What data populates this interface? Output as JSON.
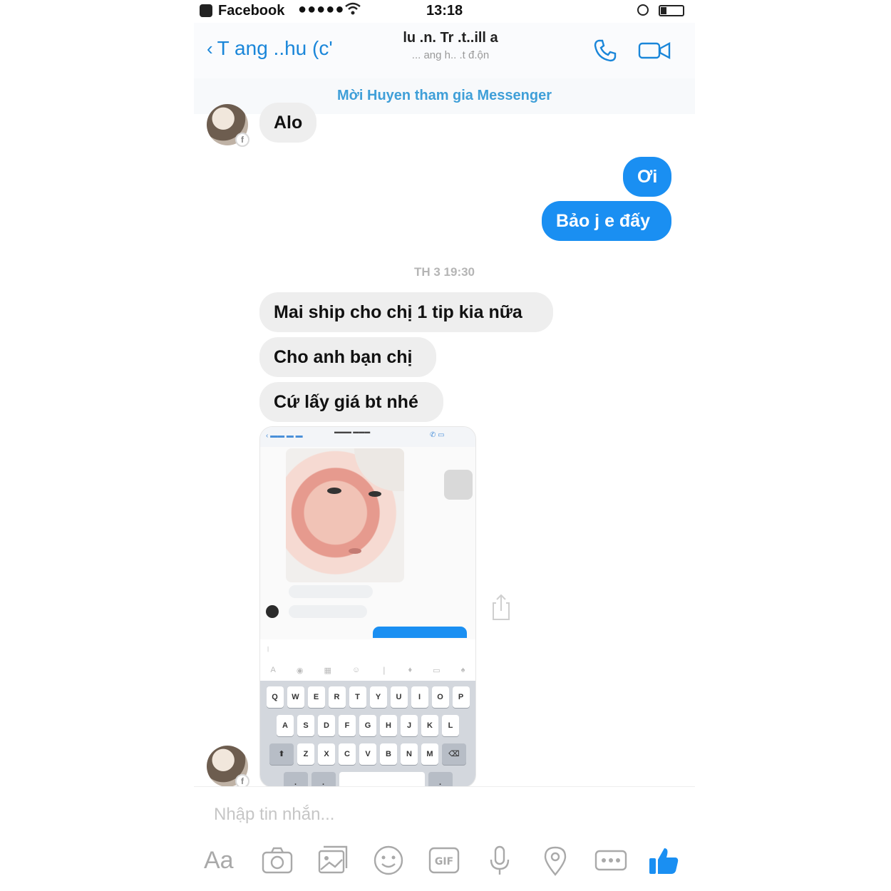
{
  "status_bar": {
    "carrier": "Facebook",
    "signal": "●●●●●",
    "time": "13:18"
  },
  "header": {
    "back_label": "T ang ..hu (c'",
    "contact_name": "lu .n. Tr .t..ill a",
    "contact_status": "... ang h.. .t đ.ộn"
  },
  "invite_banner": "Mời Huyen tham gia Messenger",
  "messages": {
    "m1": "Alo",
    "m2": "Ơi",
    "m3": "Bảo j e đấy",
    "timestamp": "TH 3 19:30",
    "m4": "Mai ship cho chị 1 tip kia nữa",
    "m5": "Cho anh bạn chị",
    "m6": "Cứ lấy giá bt nhé"
  },
  "composer": {
    "placeholder": "Nhập tin nhắn...",
    "aa_label": "Aa"
  },
  "icons": {
    "back": "chevron-left-icon",
    "call": "phone-icon",
    "video": "video-camera-icon",
    "camera": "camera-icon",
    "gallery": "photo-gallery-icon",
    "emoji": "emoji-icon",
    "gif": "gif-icon",
    "mic": "microphone-icon",
    "location": "location-pin-icon",
    "more": "more-icon",
    "like": "thumbs-up-icon"
  },
  "colors": {
    "accent_blue": "#1a8ff2",
    "incoming_bubble": "#eeeeee",
    "invite_text": "#3f9fd8",
    "icon_grey": "#a9a9a9"
  }
}
